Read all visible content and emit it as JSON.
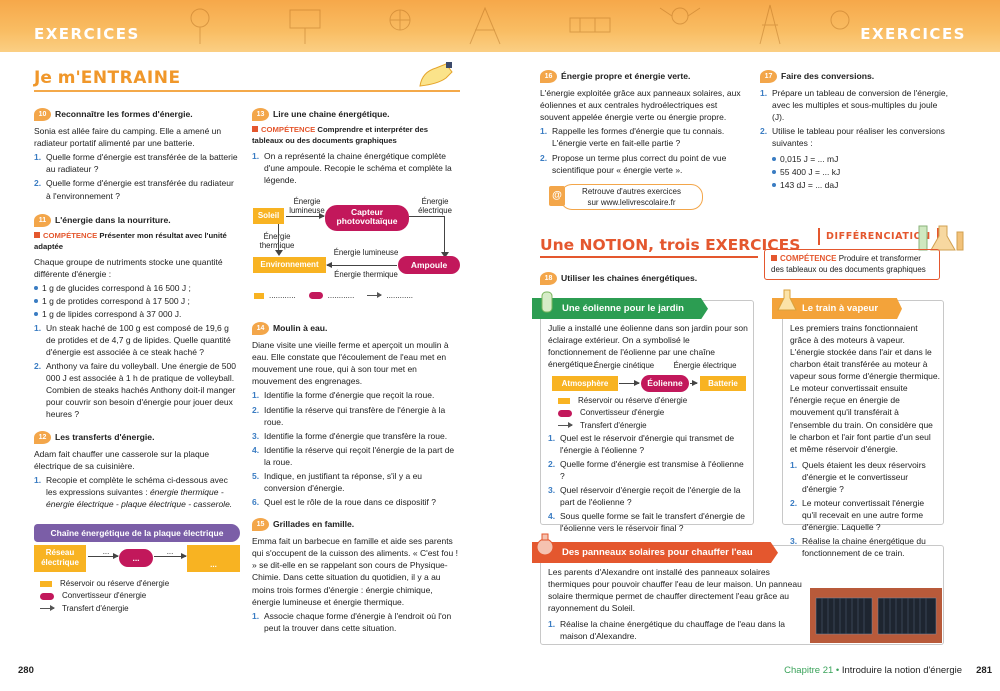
{
  "banner": {
    "title_left": "EXERCICES",
    "title_right": "EXERCICES"
  },
  "colors": {
    "orange": "#f3a64a",
    "green": "#2c9d52",
    "red": "#e4572e",
    "purple": "#7b5ea7",
    "yellow": "#f8b322",
    "magenta": "#c2185b",
    "blue": "#3a7cc2"
  },
  "section_entraine": {
    "prefix": "Je m'",
    "word": "ENTRAINE"
  },
  "ex10": {
    "num": "10",
    "title": "Reconnaître les formes d'énergie.",
    "intro": "Sonia est allée faire du camping. Elle a amené un radiateur portatif alimenté par une batterie.",
    "q1": "Quelle forme d'énergie est transférée de la batterie au radiateur ?",
    "q2": "Quelle forme d'énergie est transférée du radiateur à l'environnement ?"
  },
  "ex11": {
    "num": "11",
    "title": "L'énergie dans la nourriture.",
    "comp_label": "COMPÉTENCE",
    "comp_text": "Présenter mon résultat avec l'unité adaptée",
    "intro": "Chaque groupe de nutriments stocke une quantité différente d'énergie :",
    "b1": "1 g de glucides correspond à 16 500 J ;",
    "b2": "1 g de protides correspond à 17 500 J ;",
    "b3": "1 g de lipides correspond à 37 000 J.",
    "q1": "Un steak haché de 100 g est composé de 19,6 g de protides et de 4,7 g de lipides. Quelle quantité d'énergie est associée à ce steak haché ?",
    "q2": "Anthony va faire du volleyball. Une énergie de 500 000 J est associée à 1 h de pratique de volleyball. Combien de steaks hachés Anthony doit-il manger pour couvrir son besoin d'énergie pour jouer deux heures ?"
  },
  "ex12": {
    "num": "12",
    "title": "Les transferts d'énergie.",
    "intro": "Adam fait chauffer une casserole sur la plaque électrique de sa cuisinière.",
    "q1a": "Recopie et complète le schéma ci-dessous avec les expressions suivantes : ",
    "q1b": "énergie thermique - énergie électrique - plaque électrique - casserole.",
    "bar": "Chaîne énergétique de la plaque électrique",
    "box1": "Réseau électrique",
    "dots": "...",
    "leg1": "Réservoir ou réserve d'énergie",
    "leg2": "Convertisseur d'énergie",
    "leg3": "Transfert d'énergie"
  },
  "ex13": {
    "num": "13",
    "title": "Lire une chaine énergétique.",
    "comp_label": "COMPÉTENCE",
    "comp_text": "Comprendre et interpréter des tableaux ou des documents graphiques",
    "q1": "On a représenté la chaine énergétique complète d'une ampoule. Recopie le schéma et complète la légende.",
    "soleil": "Soleil",
    "capteur": "Capteur photovoltaïque",
    "environnement": "Environnement",
    "ampoule": "Ampoule",
    "e_lum1": "Énergie lumineuse",
    "e_elec": "Énergie électrique",
    "e_therm1": "Énergie thermique",
    "e_lum2": "Énergie lumineuse",
    "e_therm2": "Énergie thermique",
    "leg_dots": "............"
  },
  "ex14": {
    "num": "14",
    "title": "Moulin à eau.",
    "intro": "Diane visite une vieille ferme et aperçoit un moulin à eau. Elle constate que l'écoulement de l'eau met en mouvement une roue, qui à son tour met en mouvement des engrenages.",
    "q1": "Identifie la forme d'énergie que reçoit la roue.",
    "q2": "Identifie la réserve qui transfère de l'énergie à la roue.",
    "q3": "Identifie la forme d'énergie que transfère la roue.",
    "q4": "Identifie la réserve qui reçoit l'énergie de la part de la roue.",
    "q5": "Indique, en justifiant ta réponse, s'il y a eu conversion d'énergie.",
    "q6": "Quel est le rôle de la roue dans ce dispositif ?"
  },
  "ex15": {
    "num": "15",
    "title": "Grillades en famille.",
    "intro": "Emma fait un barbecue en famille et aide ses parents qui s'occupent de la cuisson des aliments. « C'est fou ! » se dit-elle en se rappelant son cours de Physique-Chimie. Dans cette situation du quotidien, il y a au moins trois formes d'énergie : énergie chimique, énergie lumineuse et énergie thermique.",
    "q1": "Associe chaque forme d'énergie à l'endroit où l'on peut la trouver dans cette situation."
  },
  "ex16": {
    "num": "16",
    "title": "Énergie propre et énergie verte.",
    "intro": "L'énergie exploitée grâce aux panneaux solaires, aux éoliennes et aux centrales hydroélectriques est souvent appelée énergie verte ou énergie propre.",
    "q1": "Rappelle les formes d'énergie que tu connais. L'énergie verte en fait-elle partie ?",
    "q2": "Propose un terme plus correct du point de vue scientifique pour « énergie verte ».",
    "link1": "Retrouve d'autres exercices",
    "link2": "sur www.lelivrescolaire.fr"
  },
  "ex17": {
    "num": "17",
    "title": "Faire des conversions.",
    "q1": "Prépare un tableau de conversion de l'énergie, avec les multiples et sous-multiples du joule (J).",
    "q2": "Utilise le tableau pour réaliser les conversions suivantes :",
    "c1": "0,015 J = ... mJ",
    "c2": "55 400 J = ... kJ",
    "c3": "143 dJ = ... daJ"
  },
  "notion": {
    "w1": "Une ",
    "w2": "NOTION",
    "w3": ", trois ",
    "w4": "EXERCICES"
  },
  "differenciation": "DIFFÉRENCIATION",
  "diff_comp": {
    "label": "COMPÉTENCE",
    "text": "Produire et transformer des tableaux ou des documents graphiques"
  },
  "ex18": {
    "num": "18",
    "title": "Utiliser les chaines énergétiques."
  },
  "eolienne": {
    "bar": "Une éolienne pour le jardin",
    "intro": "Julie a installé une éolienne dans son jardin pour son éclairage extérieur. On a symbolisé le fonctionnement de l'éolienne par une chaîne énergétique.",
    "e_cin": "Énergie cinétique",
    "e_elec": "Énergie électrique",
    "atm": "Atmosphère",
    "eol": "Éolienne",
    "bat": "Batterie",
    "leg1": "Réservoir ou réserve d'énergie",
    "leg2": "Convertisseur d'énergie",
    "leg3": "Transfert d'énergie",
    "q1": "Quel est le réservoir d'énergie qui transmet de l'énergie à l'éolienne ?",
    "q2": "Quelle forme d'énergie est transmise à l'éolienne ?",
    "q3": "Quel réservoir d'énergie reçoit de l'énergie de la part de l'éolienne ?",
    "q4": "Sous quelle forme se fait le transfert d'énergie de l'éolienne vers le réservoir final ?"
  },
  "train": {
    "bar": "Le train à vapeur",
    "intro": "Les premiers trains fonctionnaient grâce à des moteurs à vapeur. L'énergie stockée dans l'air et dans le charbon était transférée au moteur à vapeur sous forme d'énergie thermique. Le moteur convertissait ensuite l'énergie reçue en énergie de mouvement qu'il transférait à l'ensemble du train. On considère que le charbon et l'air font partie d'un seul et même réservoir d'énergie.",
    "q1": "Quels étaient les deux réservoirs d'énergie et le convertisseur d'énergie ?",
    "q2": "Le moteur convertissait l'énergie qu'il recevait en une autre forme d'énergie. Laquelle ?",
    "q3": "Réalise la chaine énergétique du fonctionnement de ce train."
  },
  "solaire": {
    "bar": "Des panneaux solaires pour chauffer l'eau",
    "intro": "Les parents d'Alexandre ont installé des panneaux solaires thermiques pour pouvoir chauffer l'eau de leur maison. Un panneau solaire thermique permet de chauffer directement l'eau grâce au rayonnement du Soleil.",
    "q1": "Réalise la chaine énergétique du chauffage de l'eau dans la maison d'Alexandre."
  },
  "footer": {
    "left_page": "280",
    "right_page": "281",
    "chapter": "Chapitre 21",
    "sep": " • ",
    "chapter_title": "Introduire la notion d'énergie"
  }
}
